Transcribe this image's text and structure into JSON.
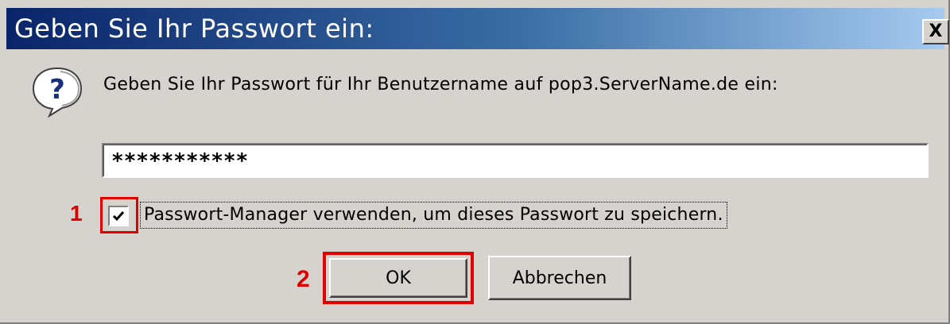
{
  "dialog": {
    "title": "Geben Sie Ihr Passwort ein:",
    "close_label": "X",
    "prompt": "Geben Sie Ihr Passwort für Ihr Benutzername auf pop3.ServerName.de ein:",
    "password_value": "***********",
    "remember_checked": true,
    "remember_label": "Passwort-Manager verwenden, um dieses Passwort zu speichern.",
    "ok_label": "OK",
    "cancel_label": "Abbrechen"
  },
  "annotations": {
    "marker_1": "1",
    "marker_2": "2",
    "highlight_color": "#e00000"
  },
  "icons": {
    "question": "question-icon",
    "close": "close-icon",
    "check": "checkmark-icon"
  }
}
